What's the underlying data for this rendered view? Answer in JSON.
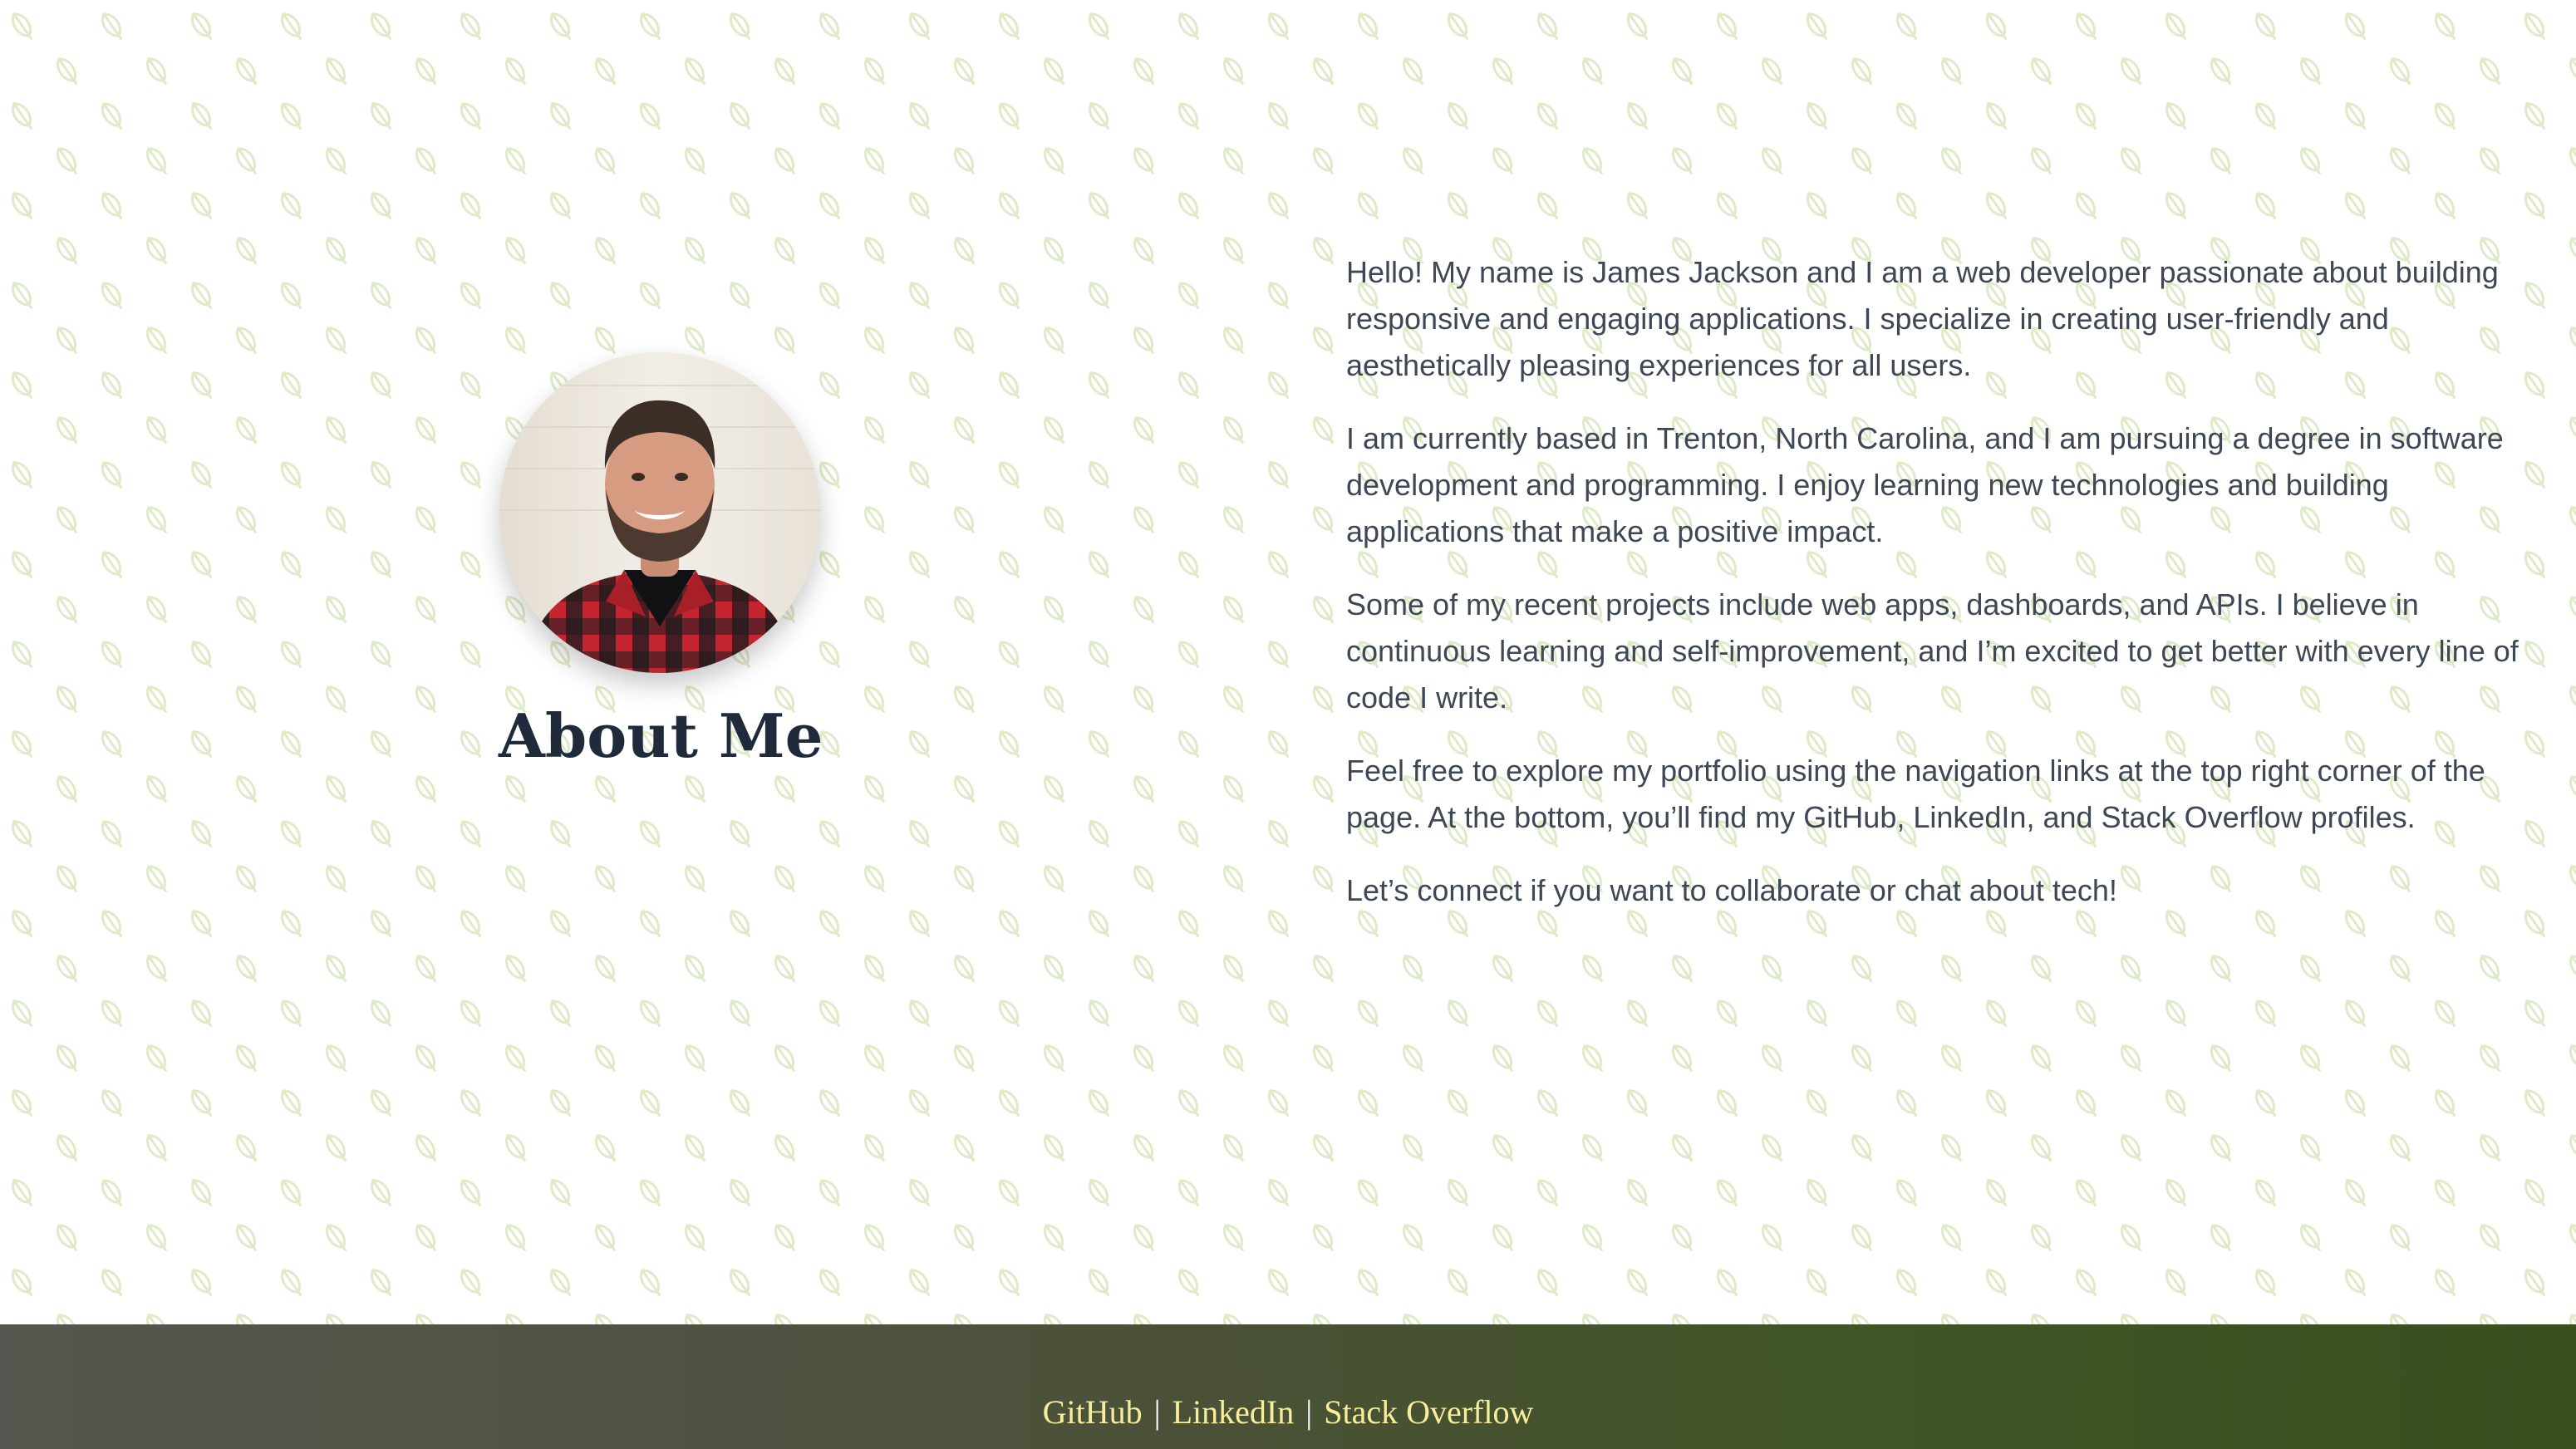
{
  "colors": {
    "heading": "#1f2b3b",
    "body_text": "#3d4756",
    "leaf_pattern": "#dfeac8",
    "footer_start": "#56554f",
    "footer_end": "#3a4e1e",
    "footer_link": "#f7ee9c"
  },
  "about": {
    "avatar_alt": "Photo of James Jackson",
    "title": "About Me",
    "paragraphs": [
      "Hello! My name is James Jackson and I am a web developer passionate about building responsive and engaging applications. I specialize in creating user-friendly and aesthetically pleasing experiences for all users.",
      "I am currently based in Trenton, North Carolina, and I am pursuing a degree in software development and programming. I enjoy learning new technologies and building applications that make a positive impact.",
      "Some of my recent projects include web apps, dashboards, and APIs. I believe in continuous learning and self-improvement, and I’m excited to get better with every line of code I write.",
      "Feel free to explore my portfolio using the navigation links at the top right corner of the page. At the bottom, you’ll find my GitHub, LinkedIn, and Stack Overflow profiles.",
      "Let’s connect if you want to collaborate or chat about tech!"
    ]
  },
  "footer": {
    "links": [
      {
        "label": "GitHub"
      },
      {
        "label": "LinkedIn"
      },
      {
        "label": "Stack Overflow"
      }
    ],
    "separator": "|"
  }
}
